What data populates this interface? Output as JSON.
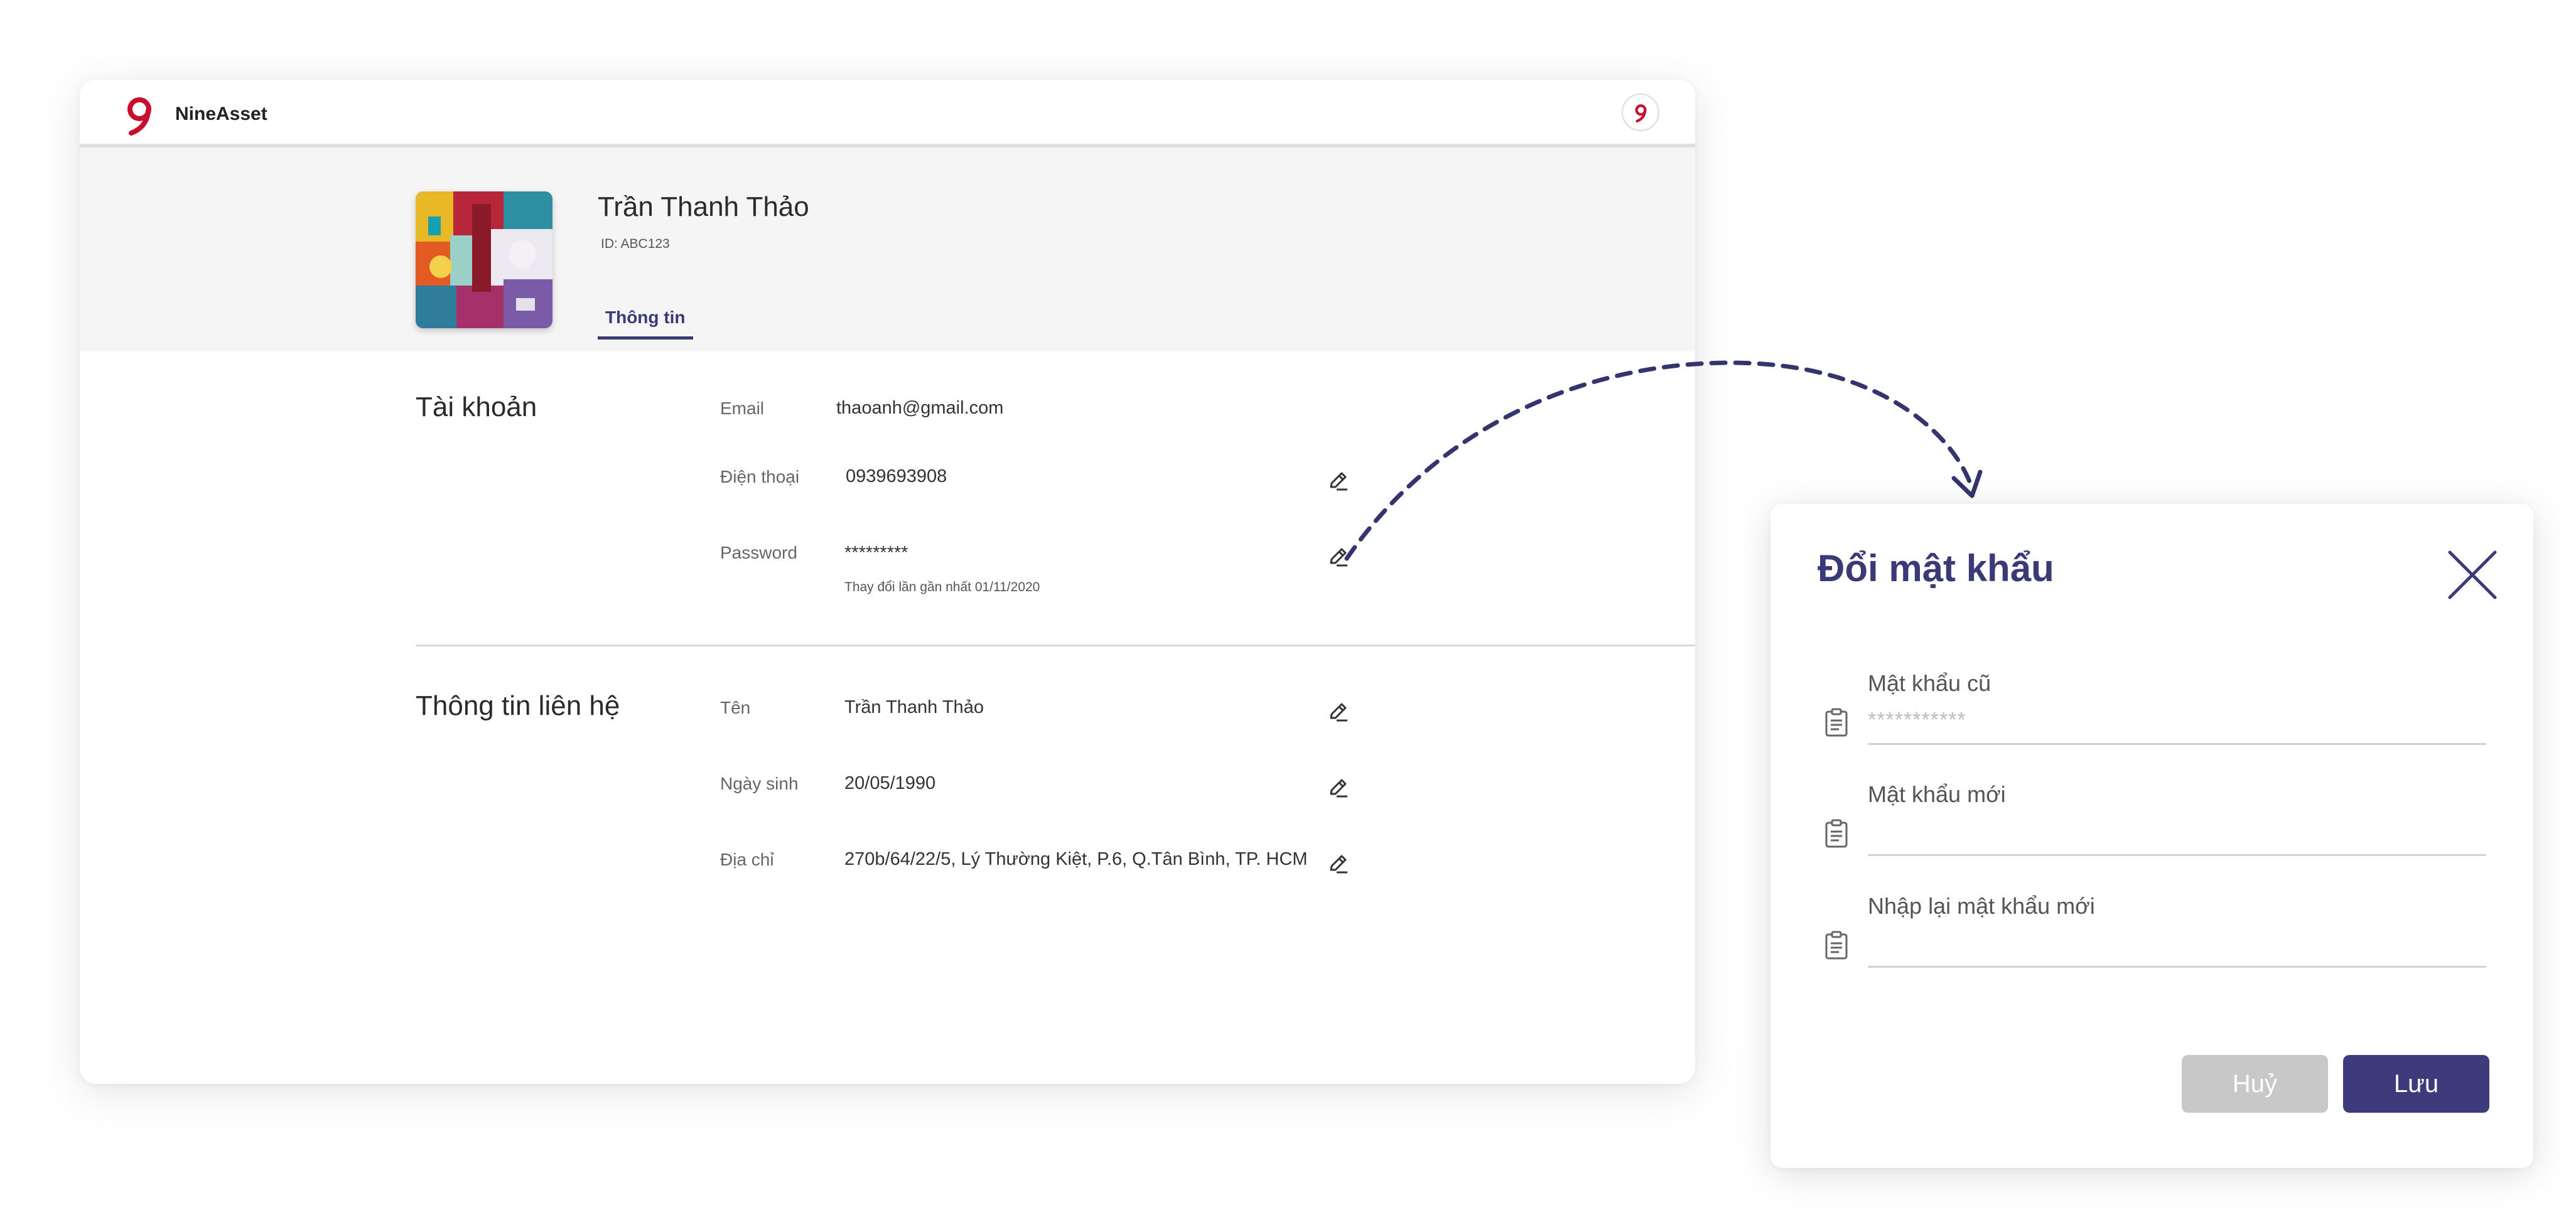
{
  "app": {
    "brand": "NineAsset"
  },
  "profile": {
    "name": "Trần Thanh Thảo",
    "id_text": "ID: ABC123",
    "tab_label": "Thông tin"
  },
  "account": {
    "title": "Tài khoản",
    "email_label": "Email",
    "email_value": "thaoanh@gmail.com",
    "phone_label": "Điện thoại",
    "phone_value": "0939693908",
    "password_label": "Password",
    "password_value": "*********",
    "password_note": "Thay đổi lần gần nhất 01/11/2020"
  },
  "contact": {
    "title": "Thông tin liên hệ",
    "name_label": "Tên",
    "name_value": "Trần Thanh Thảo",
    "dob_label": "Ngày sinh",
    "dob_value": "20/05/1990",
    "address_label": "Địa chỉ",
    "address_value": "270b/64/22/5, Lý Thường Kiệt, P.6, Q.Tân Bình, TP. HCM"
  },
  "modal": {
    "title": "Đổi mật khẩu",
    "old_password_label": "Mật khẩu cũ",
    "old_password_value": "***********",
    "new_password_label": "Mật khẩu mới",
    "new_password_value": "",
    "confirm_password_label": "Nhập lại mật khẩu mới",
    "confirm_password_value": "",
    "cancel_label": "Huỷ",
    "save_label": "Lưu"
  },
  "colors": {
    "accent": "#3a3a78",
    "logo_red": "#c8102e",
    "cancel_bg": "#c8c8c8",
    "save_bg": "#3d3b7b"
  }
}
